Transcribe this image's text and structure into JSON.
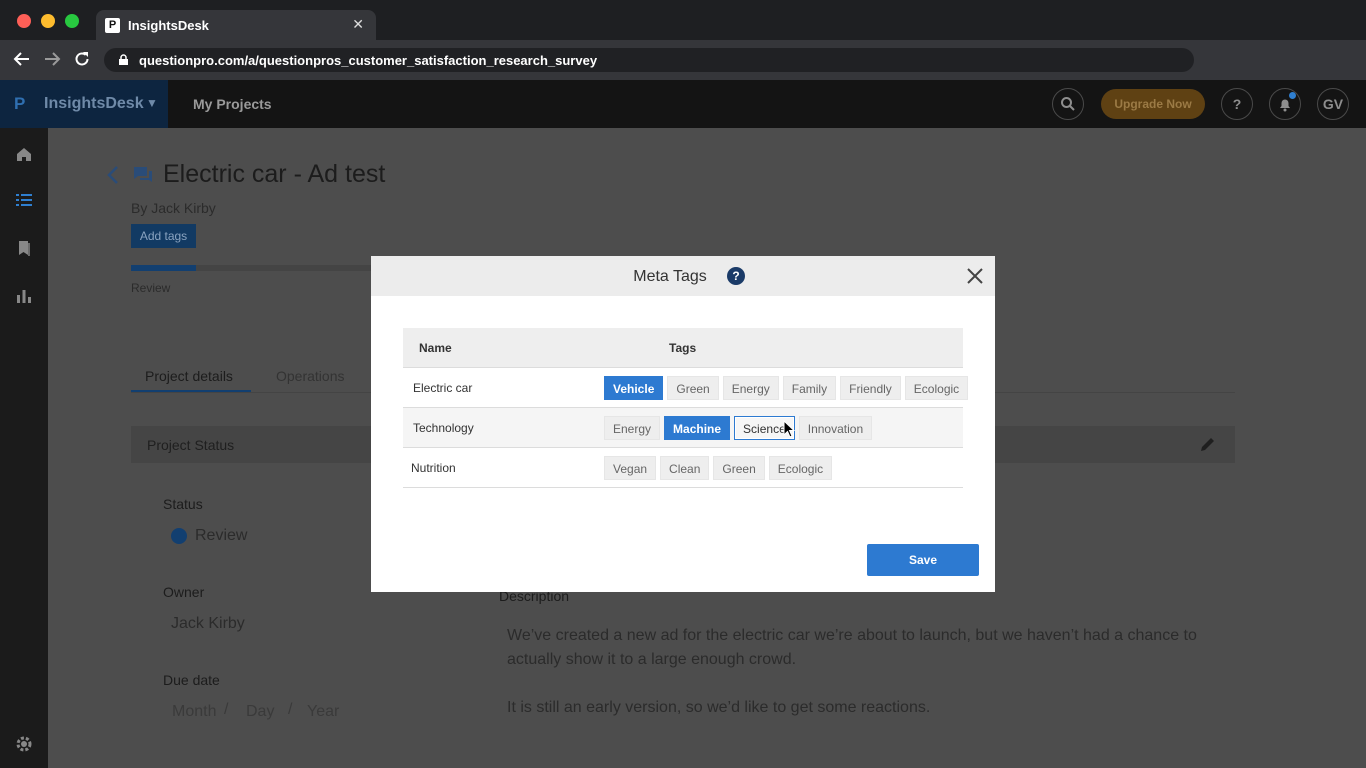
{
  "browser": {
    "tab_title": "InsightsDesk",
    "favicon_letter": "P",
    "tab_close": "✕",
    "url": "questionpro.com/a/questionpros_customer_satisfaction_research_survey"
  },
  "app_header": {
    "brand_logo": "P",
    "brand": "InsightsDesk",
    "my_projects": "My Projects",
    "upgrade": "Upgrade Now",
    "help": "?",
    "avatar": "GV"
  },
  "project": {
    "title": "Electric car - Ad test",
    "byline": "By Jack Kirby",
    "add_tags": "Add tags",
    "progress_fraction": 0.27,
    "progress_label": "Review",
    "tabs": [
      "Project details",
      "Operations"
    ],
    "section_title": "Project Status",
    "status_label": "Status",
    "status_value": "Review",
    "owner_label": "Owner",
    "owner_value": "Jack Kirby",
    "due_label": "Due date",
    "due_month": "Month",
    "due_day": "Day",
    "due_year": "Year",
    "due_sep": "/",
    "description_label": "Description",
    "description_p1": "We’ve created a new ad for the electric car we’re about to launch, but we haven’t had a chance to actually show it to a large enough crowd.",
    "description_p2": "It is still an early version, so we’d like to get some reactions."
  },
  "modal": {
    "title": "Meta Tags",
    "help": "?",
    "columns": {
      "name": "Name",
      "tags": "Tags"
    },
    "rows": [
      {
        "name": "Electric car",
        "tags": [
          "Vehicle",
          "Green",
          "Energy",
          "Family",
          "Friendly",
          "Ecologic"
        ]
      },
      {
        "name": "Technology",
        "tags": [
          "Energy",
          "Machine",
          "Science",
          "Innovation"
        ]
      },
      {
        "name": "Nutrition",
        "tags": [
          "Vegan",
          "Clean",
          "Green",
          "Ecologic"
        ]
      }
    ],
    "save": "Save"
  },
  "colors": {
    "accent": "#2d7ad1",
    "selected_tag": "#2d7ad1",
    "overlay_dim": "#4d4d4d"
  }
}
